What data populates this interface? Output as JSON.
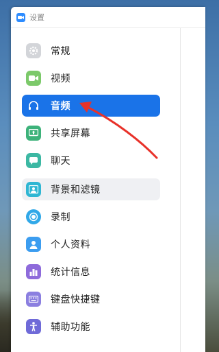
{
  "window": {
    "title": "设置"
  },
  "sidebar": {
    "items": [
      {
        "label": "常规",
        "icon": "gear-icon",
        "color": "#c9cbd0"
      },
      {
        "label": "视频",
        "icon": "video-camera-icon",
        "color": "#7cc96a"
      },
      {
        "label": "音频",
        "icon": "headphones-icon",
        "color": "#1a73e8",
        "active": true
      },
      {
        "label": "共享屏幕",
        "icon": "share-screen-icon",
        "color": "#3db27a"
      },
      {
        "label": "聊天",
        "icon": "chat-bubble-icon",
        "color": "#3cb8a3"
      },
      {
        "label": "背景和滤镜",
        "icon": "background-image-icon",
        "color": "#2fb6d3",
        "highlighted": true
      },
      {
        "label": "录制",
        "icon": "record-icon",
        "color": "#30a8e8"
      },
      {
        "label": "个人资料",
        "icon": "person-icon",
        "color": "#3c9df0"
      },
      {
        "label": "统计信息",
        "icon": "bar-chart-icon",
        "color": "#8e6bdb"
      },
      {
        "label": "键盘快捷键",
        "icon": "keyboard-icon",
        "color": "#8b7fe0"
      },
      {
        "label": "辅助功能",
        "icon": "accessibility-icon",
        "color": "#6f6ad8"
      }
    ]
  },
  "annotation": {
    "arrow_color": "#e8322a"
  }
}
